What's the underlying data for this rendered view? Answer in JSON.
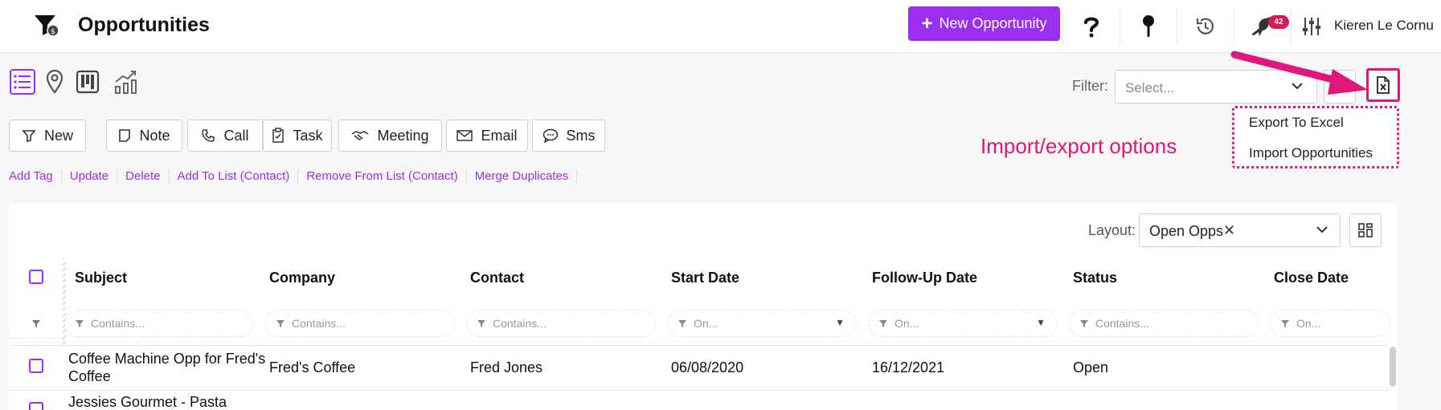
{
  "header": {
    "title": "Opportunities",
    "new_button_label": "New Opportunity",
    "user_name": "Kieren Le Cornu",
    "notification_count": "42"
  },
  "toolbar": {
    "filter_label": "Filter:",
    "filter_placeholder": "Select...",
    "export_menu": {
      "items": [
        "Export To Excel",
        "Import Opportunities"
      ]
    },
    "annotation": "Import/export options"
  },
  "actions": {
    "buttons": [
      "New",
      "Note",
      "Call",
      "Task",
      "Meeting",
      "Email",
      "Sms"
    ],
    "links": [
      "Add Tag",
      "Update",
      "Delete",
      "Add To List (Contact)",
      "Remove From List (Contact)",
      "Merge Duplicates"
    ]
  },
  "table": {
    "layout_label": "Layout:",
    "layout_value": "Open Opps",
    "columns": [
      "Subject",
      "Company",
      "Contact",
      "Start Date",
      "Follow-Up Date",
      "Status",
      "Close Date"
    ],
    "filter_placeholders": [
      "Contains...",
      "Contains...",
      "Contains...",
      "On...",
      "On...",
      "Contains...",
      "On..."
    ],
    "rows": [
      {
        "subject": [
          "Coffee Machine Opp for Fred's",
          "Coffee"
        ],
        "company": "Fred's Coffee",
        "contact": "Fred Jones",
        "start_date": "06/08/2020",
        "followup_date": "16/12/2021",
        "status": "Open",
        "close_date": ""
      },
      {
        "subject": [
          "Jessies Gourmet - Pasta"
        ],
        "company": "",
        "contact": "",
        "start_date": "",
        "followup_date": "",
        "status": "",
        "close_date": ""
      }
    ]
  },
  "colors": {
    "accent": "#9b2ff0",
    "annotation": "#e0167a",
    "badge": "#d6195a"
  }
}
